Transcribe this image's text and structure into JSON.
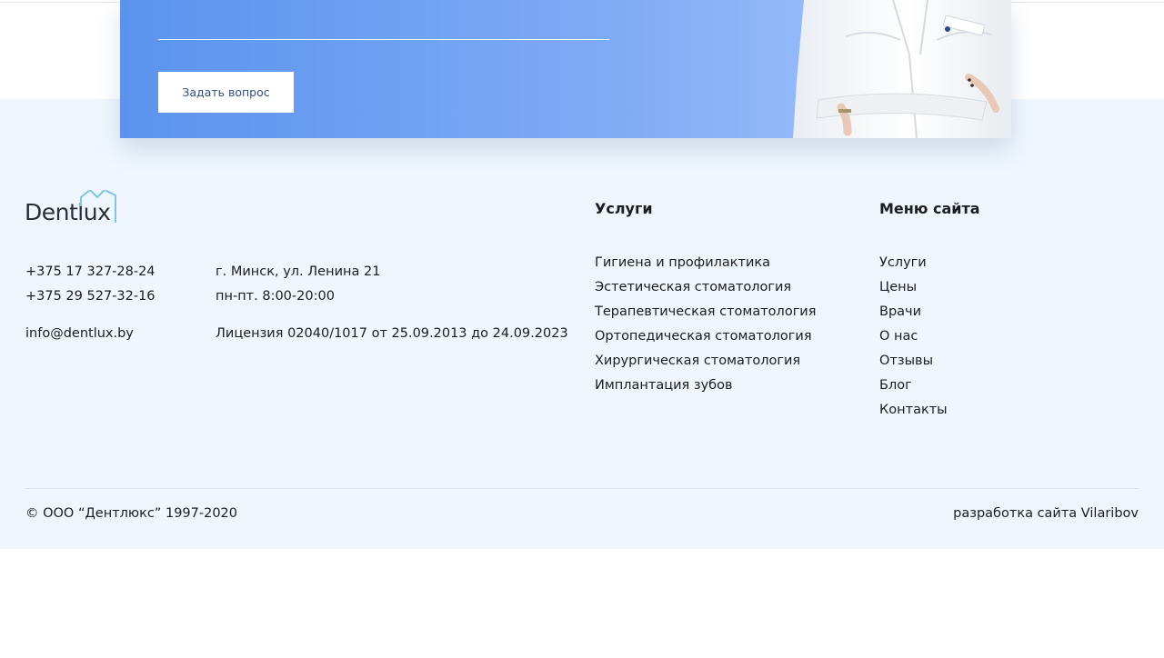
{
  "cta": {
    "button_label": "Задать вопрос"
  },
  "logo": {
    "text": "Dentlux"
  },
  "contacts": {
    "phone1": "+375 17 327-28-24",
    "phone2": "+375 29 527-32-16",
    "email": "info@dentlux.by",
    "address": "г. Минск, ул. Ленина 21",
    "hours": "пн-пт. 8:00-20:00",
    "license": "Лицензия 02040/1017 от 25.09.2013 до 24.09.2023"
  },
  "services": {
    "heading": "Услуги",
    "items": [
      "Гигиена и профилактика",
      "Эстетическая стоматология",
      "Терапевтическая стоматология",
      "Ортопедическая стоматология",
      "Хирургическая стоматология",
      "Имплантация зубов"
    ]
  },
  "site_menu": {
    "heading": "Меню сайта",
    "items": [
      "Услуги",
      "Цены",
      "Врачи",
      "О нас",
      "Отзывы",
      "Блог",
      "Контакты"
    ]
  },
  "bottom": {
    "copyright": "© ООО “Дентлюкс” 1997-2020",
    "developer": "разработка сайта Vilaribov"
  },
  "colors": {
    "footer_bg": "#eff6fd",
    "banner_gradient_start": "#5b93ee",
    "banner_gradient_end": "#a6c8ff",
    "logo_crown": "#7cc6ea"
  }
}
